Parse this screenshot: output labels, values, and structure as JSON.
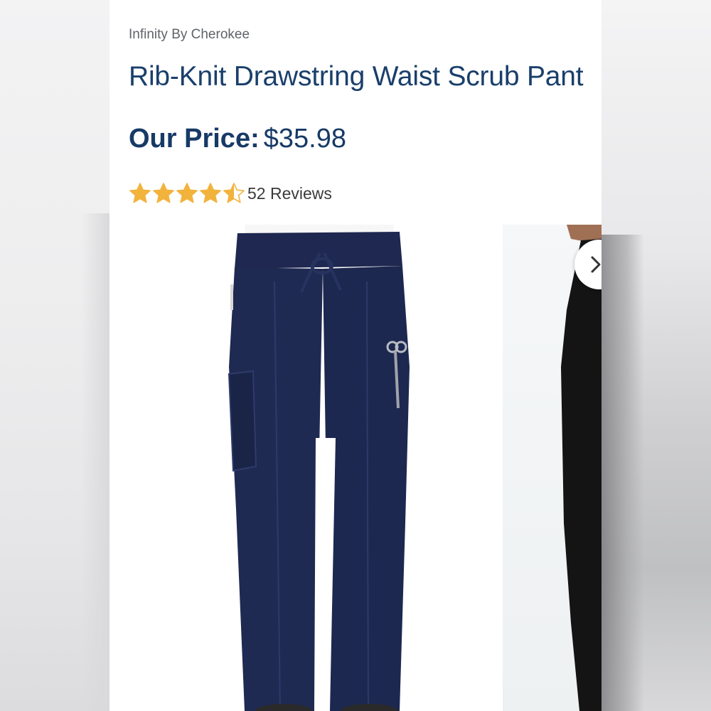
{
  "product": {
    "brand": "Infinity By Cherokee",
    "title": "Rib-Knit Drawstring Waist Scrub Pant",
    "price_label": "Our Price:",
    "price_value": "$35.98"
  },
  "rating": {
    "stars": 4.5,
    "max_stars": 5,
    "reviews_text": "52 Reviews",
    "star_color": "#f2b33d"
  },
  "gallery": {
    "main_image": "navy-scrub-pant-front-icon",
    "second_image": "black-scrub-pant-side-icon",
    "next_icon": "chevron-right-icon"
  },
  "colors": {
    "title": "#1a3f6b",
    "pant_navy": "#1f2a52",
    "pant_black": "#151515"
  }
}
